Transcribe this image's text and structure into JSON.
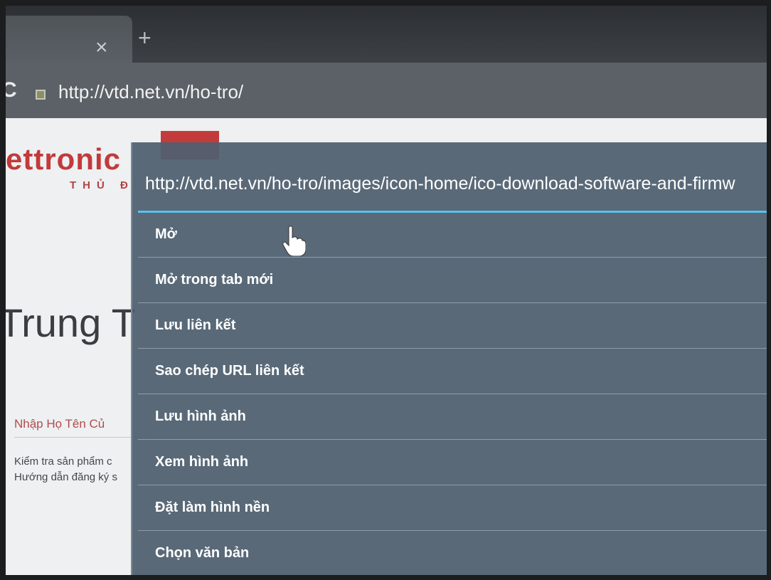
{
  "tab": {
    "close": "×",
    "new_tab": "+"
  },
  "address_bar": {
    "url": "http://vtd.net.vn/ho-tro/"
  },
  "page": {
    "logo_text": "ettronic",
    "logo_sub": "THỦ Đ",
    "heading": "Trung T",
    "field_label": "Nhập Họ Tên Củ",
    "line1": "Kiểm tra sản phẩm c",
    "line2": "Hướng dẫn đăng ký s"
  },
  "context_menu": {
    "title": "http://vtd.net.vn/ho-tro/images/icon-home/ico-download-software-and-firmw",
    "items": [
      "Mở",
      "Mở trong tab mới",
      "Lưu liên kết",
      "Sao chép URL liên kết",
      "Lưu hình ảnh",
      "Xem hình ảnh",
      "Đặt làm hình nền",
      "Chọn văn bản"
    ]
  },
  "colors": {
    "accent": "#56c3ee",
    "brand_red": "#c23a3a",
    "menu_bg": "#506070"
  }
}
